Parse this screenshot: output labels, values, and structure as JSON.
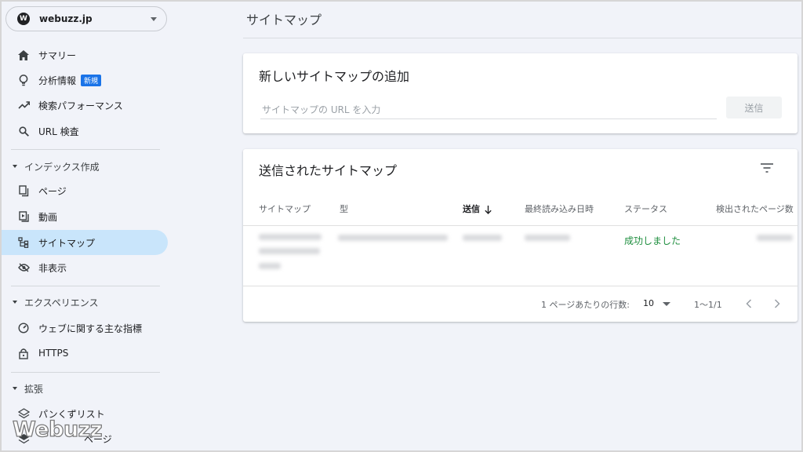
{
  "property": {
    "badge": "W",
    "name": "webuzz.jp"
  },
  "nav": {
    "summary": "サマリー",
    "insights": "分析情報",
    "insights_badge": "新規",
    "performance": "検索パフォーマンス",
    "url_inspection": "URL 検査",
    "section_index": "インデックス作成",
    "pages": "ページ",
    "videos": "動画",
    "sitemaps": "サイトマップ",
    "removals": "非表示",
    "section_experience": "エクスペリエンス",
    "core_web_vitals": "ウェブに関する主な指標",
    "https": "HTTPS",
    "section_enhancements": "拡張",
    "breadcrumbs": "パンくずリスト",
    "partial_item": "ページ"
  },
  "watermark": "Webuzz",
  "page_title": "サイトマップ",
  "add_card": {
    "title": "新しいサイトマップの追加",
    "placeholder": "サイトマップの URL を入力",
    "submit": "送信"
  },
  "submitted_card": {
    "title": "送信されたサイトマップ",
    "columns": [
      "サイトマップ",
      "型",
      "送信",
      "最終読み込み日時",
      "ステータス",
      "検出されたページ数"
    ],
    "rows": [
      {
        "status": "成功しました"
      }
    ],
    "pagination": {
      "rows_per_page_label": "1 ページあたりの行数:",
      "rows_per_page": "10",
      "range": "1〜1/1"
    }
  },
  "colors": {
    "active_bg": "#c9e5fb",
    "success": "#1e8e3e",
    "badge_blue": "#1a73e8"
  }
}
